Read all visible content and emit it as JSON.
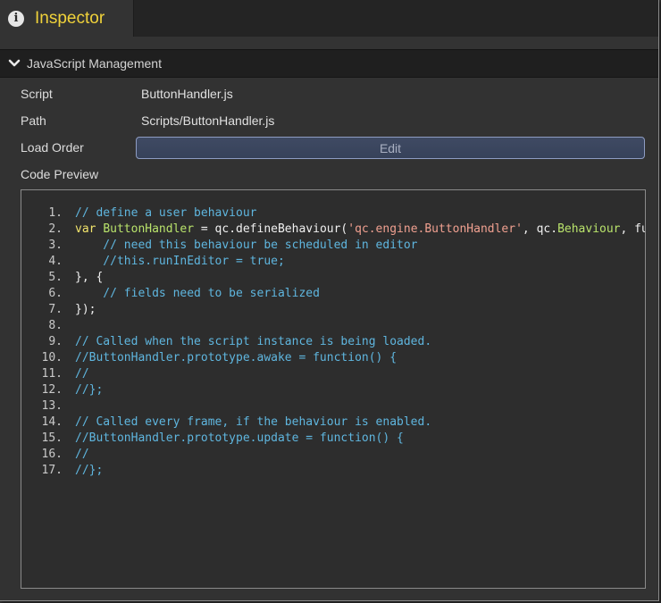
{
  "tab": {
    "title": "Inspector",
    "icon": "info-icon"
  },
  "section": {
    "title": "JavaScript Management",
    "icon": "chevron-down-icon"
  },
  "properties": {
    "script_label": "Script",
    "script_value": "ButtonHandler.js",
    "path_label": "Path",
    "path_value": "Scripts/ButtonHandler.js",
    "load_order_label": "Load Order",
    "edit_label": "Edit",
    "code_preview_label": "Code Preview"
  },
  "code": {
    "line_numbers": [
      "1.",
      "2.",
      "3.",
      "4.",
      "5.",
      "6.",
      "7.",
      "8.",
      "9.",
      "10.",
      "11.",
      "12.",
      "13.",
      "14.",
      "15.",
      "16.",
      "17."
    ],
    "lines": [
      [
        {
          "t": "comment",
          "v": "// define a user behaviour"
        }
      ],
      [
        {
          "t": "keyword",
          "v": "var "
        },
        {
          "t": "var",
          "v": "ButtonHandler"
        },
        {
          "t": "plain",
          "v": " = qc.defineBehaviour("
        },
        {
          "t": "string",
          "v": "'qc.engine.ButtonHandler'"
        },
        {
          "t": "plain",
          "v": ", qc."
        },
        {
          "t": "class",
          "v": "Behaviour"
        },
        {
          "t": "plain",
          "v": ", function() {"
        }
      ],
      [
        {
          "t": "comment",
          "v": "    // need this behaviour be scheduled in editor"
        }
      ],
      [
        {
          "t": "comment",
          "v": "    //this.runInEditor = true;"
        }
      ],
      [
        {
          "t": "plain",
          "v": "}, {"
        }
      ],
      [
        {
          "t": "comment",
          "v": "    // fields need to be serialized"
        }
      ],
      [
        {
          "t": "plain",
          "v": "});"
        }
      ],
      [],
      [
        {
          "t": "comment",
          "v": "// Called when the script instance is being loaded."
        }
      ],
      [
        {
          "t": "comment",
          "v": "//ButtonHandler.prototype.awake = function() {"
        }
      ],
      [
        {
          "t": "comment",
          "v": "//"
        }
      ],
      [
        {
          "t": "comment",
          "v": "//};"
        }
      ],
      [],
      [
        {
          "t": "comment",
          "v": "// Called every frame, if the behaviour is enabled."
        }
      ],
      [
        {
          "t": "comment",
          "v": "//ButtonHandler.prototype.update = function() {"
        }
      ],
      [
        {
          "t": "comment",
          "v": "//"
        }
      ],
      [
        {
          "t": "comment",
          "v": "//};"
        }
      ]
    ]
  }
}
